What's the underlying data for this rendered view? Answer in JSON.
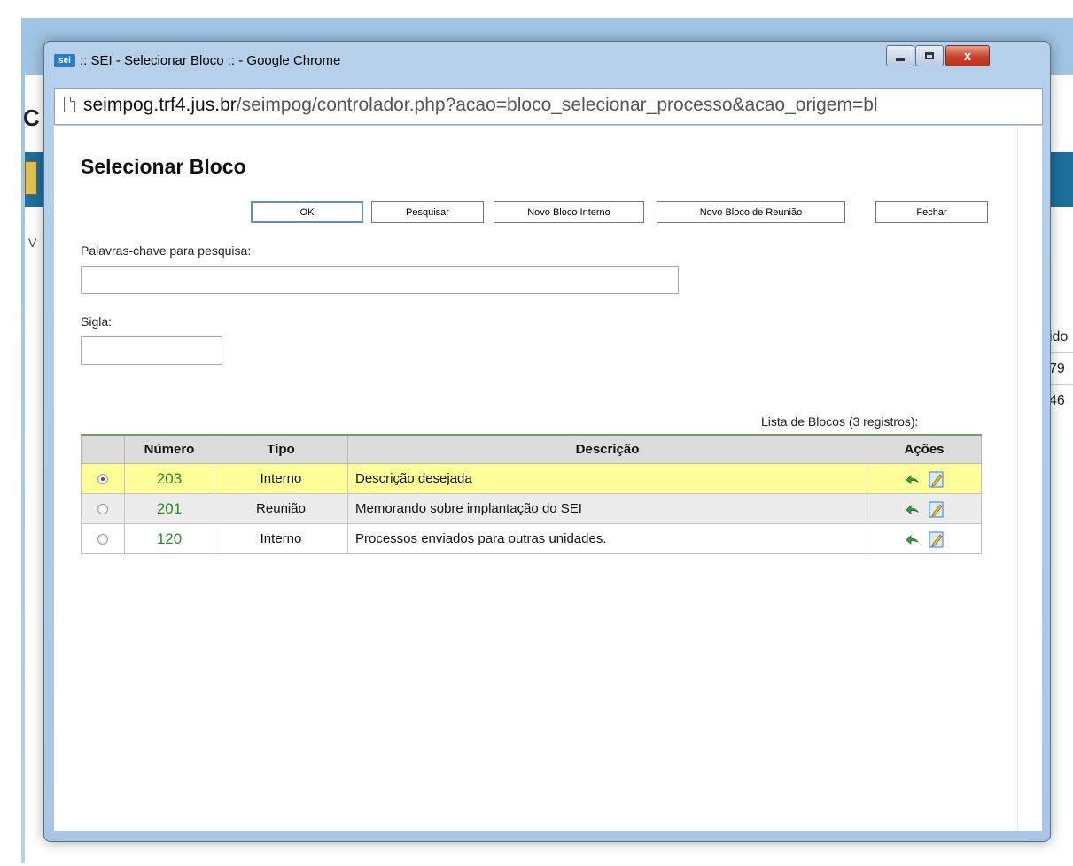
{
  "background": {
    "header_letter": "C",
    "left_letter": "V",
    "right_fragments": [
      "ido",
      "79",
      "46"
    ]
  },
  "window": {
    "logo": "sei",
    "title": ":: SEI - Selecionar Bloco :: - Google Chrome",
    "close_glyph": "x",
    "url_host": "seimpog.trf4.jus.br",
    "url_path": "/seimpog/controlador.php?acao=bloco_selecionar_processo&acao_origem=bl"
  },
  "page": {
    "title": "Selecionar Bloco",
    "buttons": {
      "ok": "OK",
      "pesquisar": "Pesquisar",
      "novo_interno": "Novo Bloco Interno",
      "novo_reuniao": "Novo Bloco de Reunião",
      "fechar": "Fechar"
    },
    "fields": {
      "palavras_label": "Palavras-chave para pesquisa:",
      "palavras_value": "",
      "sigla_label": "Sigla:",
      "sigla_value": ""
    },
    "list_caption": "Lista de Blocos (3 registros):",
    "table": {
      "headers": {
        "numero": "Número",
        "tipo": "Tipo",
        "descricao": "Descrição",
        "acoes": "Ações"
      },
      "rows": [
        {
          "numero": "203",
          "tipo": "Interno",
          "descricao": "Descrição desejada",
          "selected": true
        },
        {
          "numero": "201",
          "tipo": "Reunião",
          "descricao": "Memorando sobre implantação do SEI",
          "selected": false
        },
        {
          "numero": "120",
          "tipo": "Interno",
          "descricao": "Processos enviados para outras unidades.",
          "selected": false
        }
      ]
    }
  },
  "icons": {
    "action_arrow": "green-return-arrow-icon",
    "action_edit": "edit-pencil-icon",
    "page": "page-icon"
  },
  "colors": {
    "selected_row": "#ffff99",
    "link_number": "#2a8a2a",
    "titlebar": "#b6d0ea",
    "close_button": "#c8422a"
  }
}
